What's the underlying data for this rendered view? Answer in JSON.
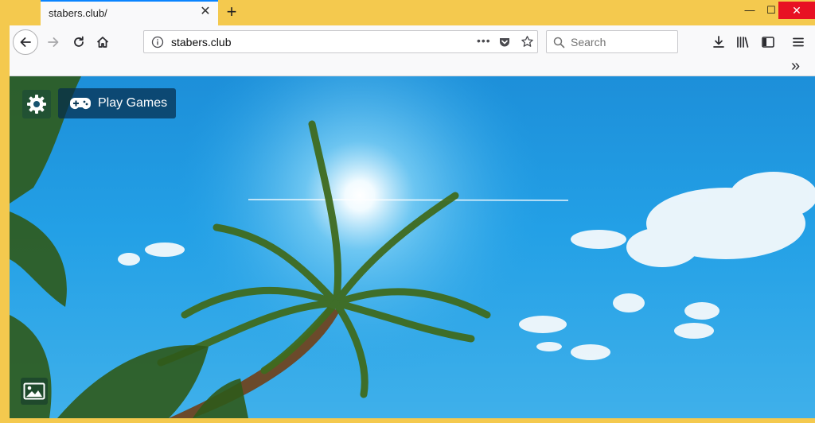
{
  "browser": {
    "tab": {
      "title": "stabers.club/",
      "close": "✕"
    },
    "new_tab": "+",
    "window_controls": {
      "minimize": "—",
      "maximize": "☐",
      "close": "✕"
    },
    "nav": {
      "back_icon": "arrow-left-icon",
      "forward_icon": "arrow-right-icon",
      "reload_icon": "reload-icon",
      "home_icon": "home-icon"
    },
    "urlbar": {
      "url": "stabers.club",
      "page_actions": "•••"
    },
    "search": {
      "placeholder": "Search"
    },
    "overflow": "»"
  },
  "page": {
    "settings_icon": "gear-icon",
    "play_games": {
      "label": "Play Games",
      "icon": "gamepad-icon"
    },
    "background_icon": "image-icon",
    "colors": {
      "sky": "#1d8fd9",
      "button_bg": "#052d4b",
      "accent": "#0a84ff"
    }
  }
}
